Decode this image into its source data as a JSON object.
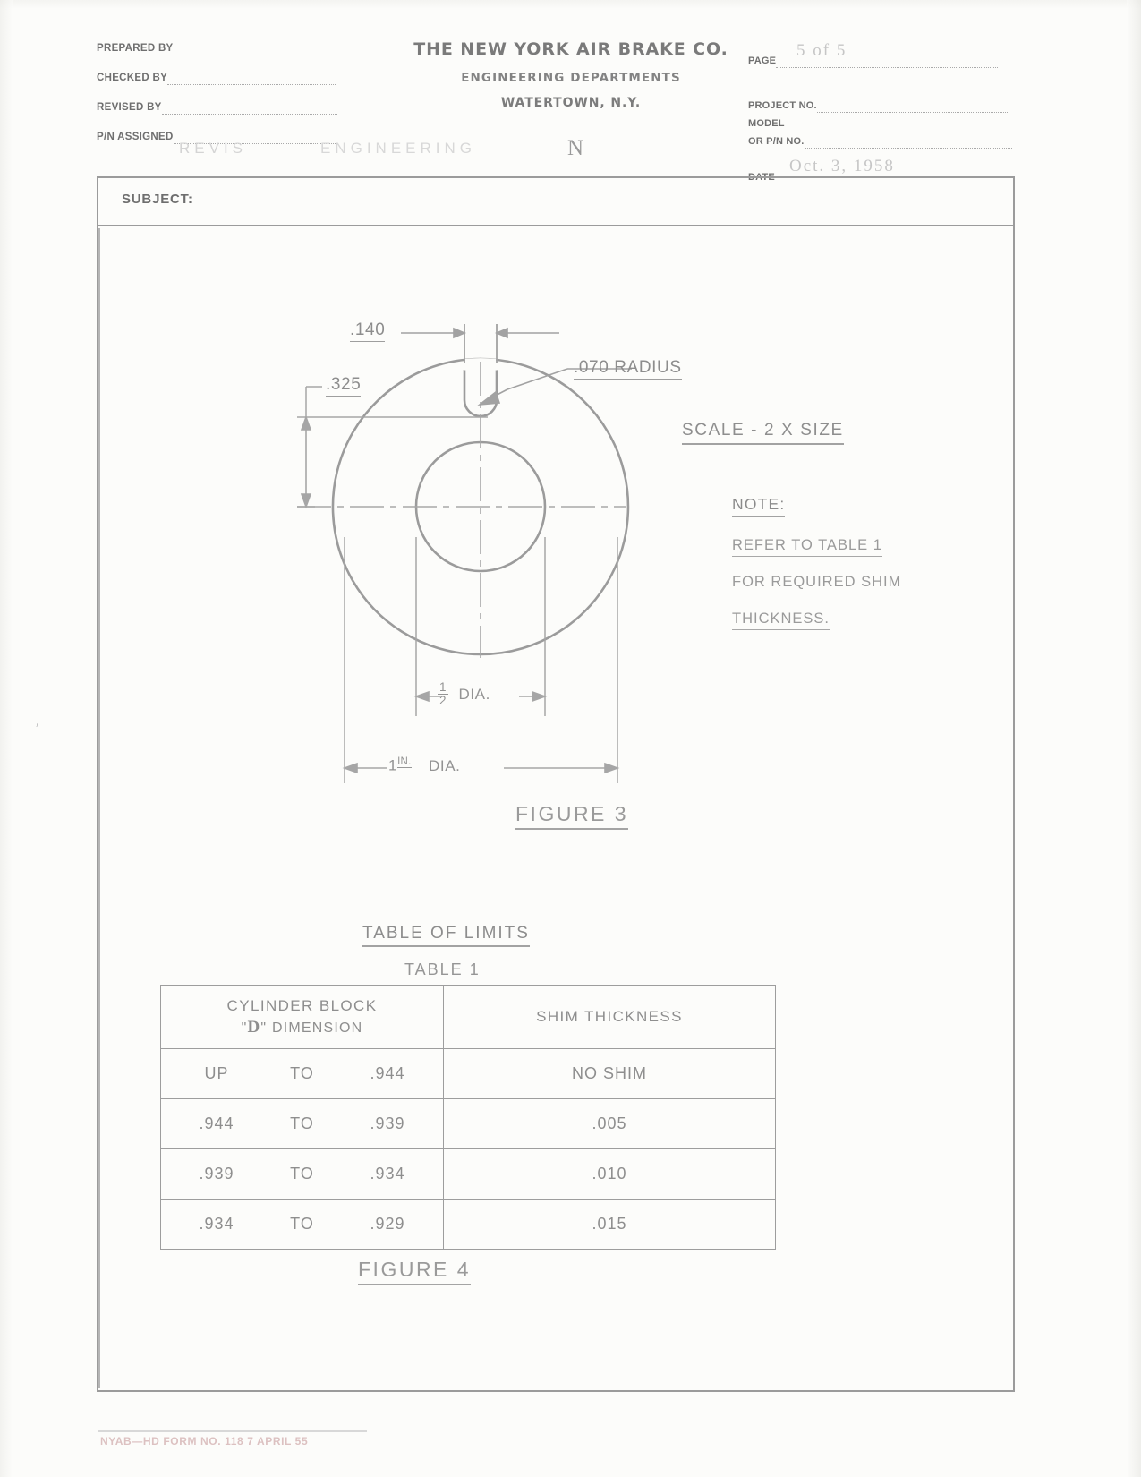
{
  "header": {
    "left_fields": [
      {
        "label": "PREPARED BY",
        "value": ""
      },
      {
        "label": "CHECKED BY",
        "value": ""
      },
      {
        "label": "REVISED BY",
        "value": ""
      },
      {
        "label": "P/N ASSIGNED",
        "value": ""
      }
    ],
    "company": "THE NEW YORK AIR BRAKE CO.",
    "department": "ENGINEERING  DEPARTMENTS",
    "city": "WATERTOWN, N.Y.",
    "ghost_mark": "N",
    "ghost_text_left": "REVIS",
    "ghost_text_right": "ENGINEERING",
    "right_fields": [
      {
        "label": "PAGE",
        "value": "5 of 5"
      },
      {
        "label": "PROJECT NO.",
        "value": ""
      },
      {
        "label": "MODEL",
        "value": ""
      },
      {
        "label": "OR P/N NO.",
        "value": ""
      },
      {
        "label": "DATE",
        "value": "Oct. 3, 1958"
      }
    ]
  },
  "subject": {
    "label": "SUBJECT:",
    "value": ""
  },
  "figure3": {
    "caption": "FIGURE   3",
    "dimensions": {
      "slot_width": ".140",
      "slot_depth": ".325",
      "radius": ".070  RADIUS",
      "bore_dia_num": "1",
      "bore_dia_den": "2",
      "bore_dia_label": "DIA.",
      "outer_dia_value": "1",
      "outer_dia_unit": "IN.",
      "outer_dia_label": "DIA."
    }
  },
  "notes": {
    "scale": "SCALE - 2  X  SIZE",
    "note_heading": "NOTE:",
    "note_lines": [
      "REFER    TO    TABLE    1",
      "FOR    REQUIRED    SHIM",
      "THICKNESS."
    ]
  },
  "table_section": {
    "title": "TABLE   OF   LIMITS",
    "subtitle": "TABLE  1",
    "caption": "FIGURE    4",
    "columns": [
      {
        "line1": "CYLINDER    BLOCK",
        "quote_open": "\"",
        "dletter": "D",
        "quote_close": "\"",
        "line2_rest": "DIMENSION"
      },
      {
        "line1": "SHIM    THICKNESS"
      }
    ],
    "rows": [
      {
        "from": "UP",
        "to": "TO",
        "upper": ".944",
        "shim": "NO    SHIM"
      },
      {
        "from": ".944",
        "to": "TO",
        "upper": ".939",
        "shim": ".005"
      },
      {
        "from": ".939",
        "to": "TO",
        "upper": ".934",
        "shim": ".010"
      },
      {
        "from": ".934",
        "to": "TO",
        "upper": ".929",
        "shim": ".015"
      }
    ]
  },
  "footer": {
    "form_number": "NYAB—HD FORM NO. 118    7 APRIL 55"
  },
  "colors": {
    "ink": "#8e8e8e",
    "rule": "#9d9d9d",
    "paper": "#fcfcfa"
  }
}
